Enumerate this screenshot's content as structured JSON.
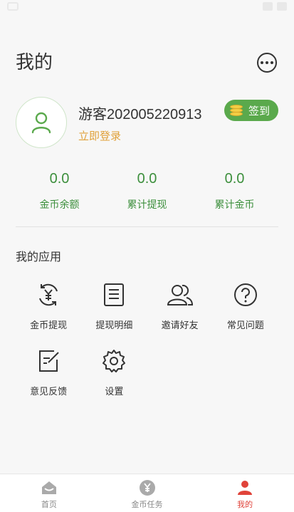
{
  "page": {
    "title": "我的"
  },
  "profile": {
    "username": "游客202005220913",
    "login_link": "立即登录",
    "signin_label": "签到"
  },
  "stats": [
    {
      "value": "0.0",
      "label": "金币余额"
    },
    {
      "value": "0.0",
      "label": "累计提现"
    },
    {
      "value": "0.0",
      "label": "累计金币"
    }
  ],
  "apps": {
    "title": "我的应用",
    "items": [
      {
        "label": "金币提现",
        "icon": "yen-refresh-icon"
      },
      {
        "label": "提现明细",
        "icon": "document-list-icon"
      },
      {
        "label": "邀请好友",
        "icon": "users-icon"
      },
      {
        "label": "常见问题",
        "icon": "question-icon"
      },
      {
        "label": "意见反馈",
        "icon": "edit-note-icon"
      },
      {
        "label": "设置",
        "icon": "gear-icon"
      }
    ]
  },
  "tabbar": {
    "items": [
      {
        "label": "首页",
        "icon": "home-icon",
        "active": false
      },
      {
        "label": "金币任务",
        "icon": "yen-coin-icon",
        "active": false
      },
      {
        "label": "我的",
        "icon": "person-icon",
        "active": true
      }
    ]
  },
  "colors": {
    "accent_green": "#5aa94c",
    "stat_green": "#3c8f3c",
    "login_orange": "#e0a13a",
    "active_red": "#e0433a"
  }
}
